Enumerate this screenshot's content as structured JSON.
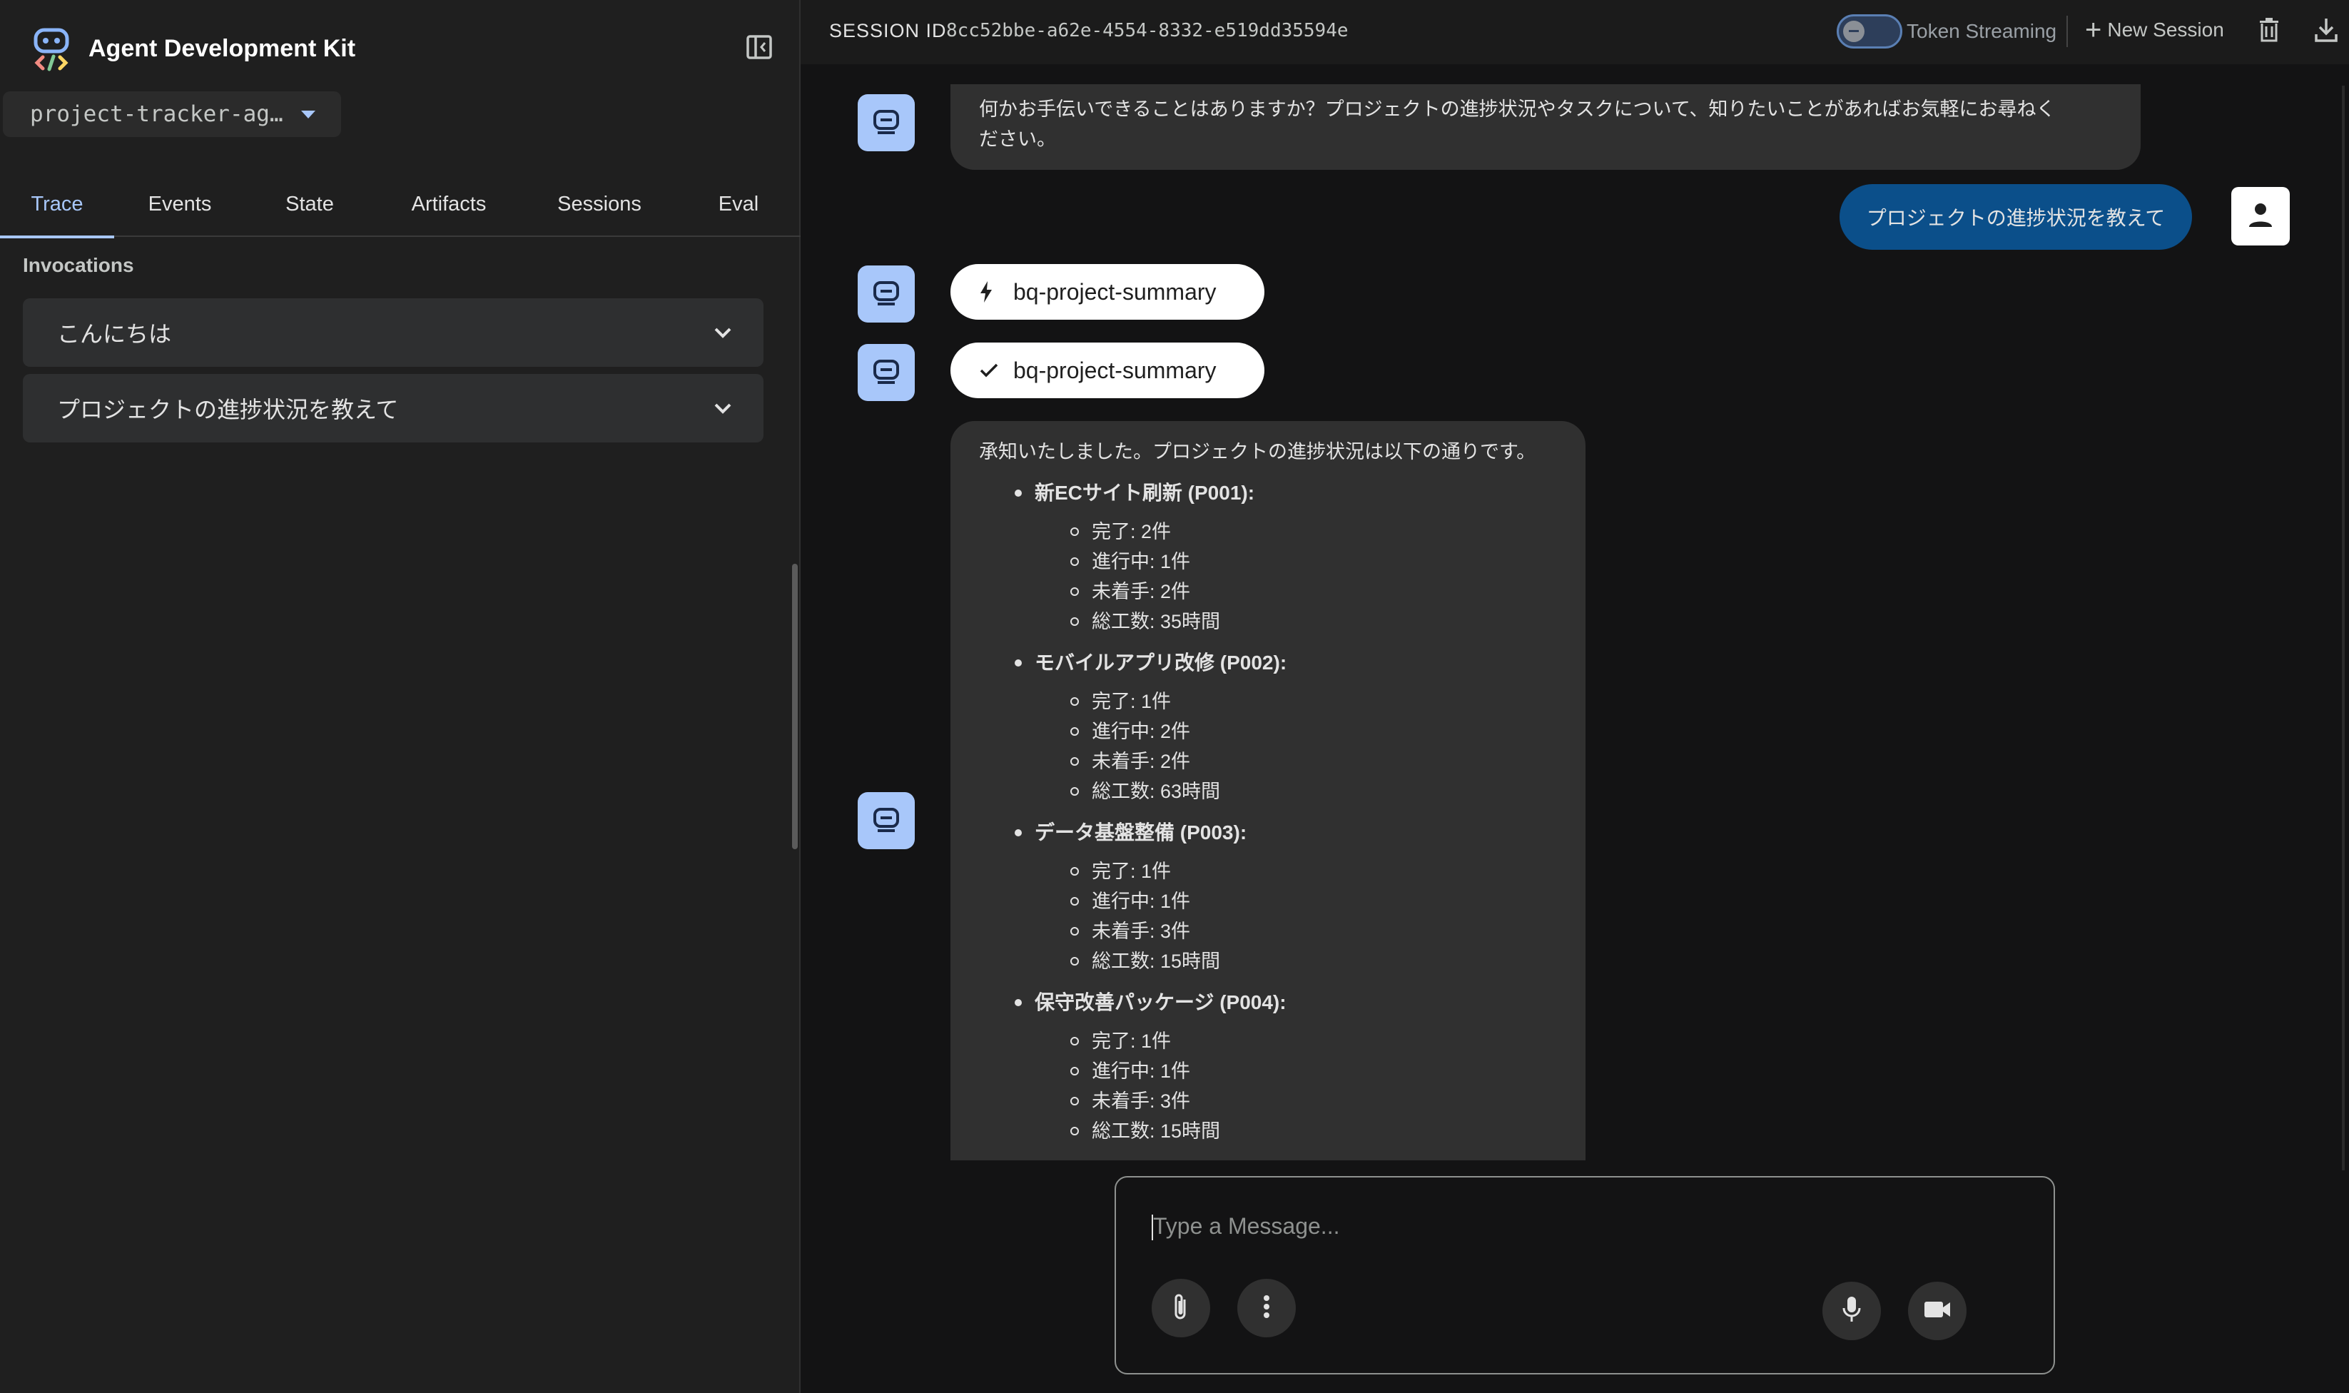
{
  "sidebar": {
    "app_title": "Agent Development Kit",
    "agent_name": "project-tracker-ag…",
    "tabs": [
      "Trace",
      "Events",
      "State",
      "Artifacts",
      "Sessions",
      "Eval"
    ],
    "active_tab": "Trace",
    "invocations_label": "Invocations",
    "invocations": [
      "こんにちは",
      "プロジェクトの進捗状況を教えて"
    ]
  },
  "topbar": {
    "session_label": "SESSION ID",
    "session_id": "8cc52bbe-a62e-4554-8332-e519dd35594e",
    "token_streaming_label": "Token Streaming",
    "token_streaming_on": false,
    "new_session_label": "New Session"
  },
  "chat": {
    "greeting": "何かお手伝いできることはありますか？プロジェクトの進捗状況やタスクについて、知りたいことがあればお気軽にお尋ねください。",
    "greeting_line1": "何かお手伝いできることはありますか？プロジェクトの進捗状況やタスクについて、知りたいことがあればお気軽にお尋ねく",
    "greeting_line2": "ださい。",
    "user_message": "プロジェクトの進捗状況を教えて",
    "tool_call": "bq-project-summary",
    "tool_response": "bq-project-summary",
    "summary_intro": "承知いたしました。プロジェクトの進捗状況は以下の通りです。",
    "projects": [
      {
        "title": "新ECサイト刷新 (P001):",
        "stats": [
          "完了: 2件",
          "進行中: 1件",
          "未着手: 2件",
          "総工数: 35時間"
        ]
      },
      {
        "title": "モバイルアプリ改修 (P002):",
        "stats": [
          "完了: 1件",
          "進行中: 2件",
          "未着手: 2件",
          "総工数: 63時間"
        ]
      },
      {
        "title": "データ基盤整備 (P003):",
        "stats": [
          "完了: 1件",
          "進行中: 1件",
          "未着手: 3件",
          "総工数: 15時間"
        ]
      },
      {
        "title": "保守改善パッケージ (P004):",
        "stats": [
          "完了: 1件",
          "進行中: 1件",
          "未着手: 3件",
          "総工数: 15時間"
        ]
      }
    ]
  },
  "input": {
    "placeholder": "Type a Message..."
  },
  "icons": {
    "logo": "adk-logo-icon",
    "collapse": "sidebar-collapse-icon",
    "chevron": "chevron-down-icon",
    "bot": "bot-icon",
    "user": "person-icon",
    "bolt": "bolt-icon",
    "check": "check-icon",
    "delete": "trash-icon",
    "download": "download-icon",
    "attach": "paperclip-icon",
    "more": "more-vert-icon",
    "mic": "mic-icon",
    "video": "videocam-icon"
  },
  "colors": {
    "accent": "#a8c7fa",
    "user_bubble": "#0b4f8a",
    "sidebar_bg": "#1f1f1f",
    "main_bg": "#131314"
  }
}
